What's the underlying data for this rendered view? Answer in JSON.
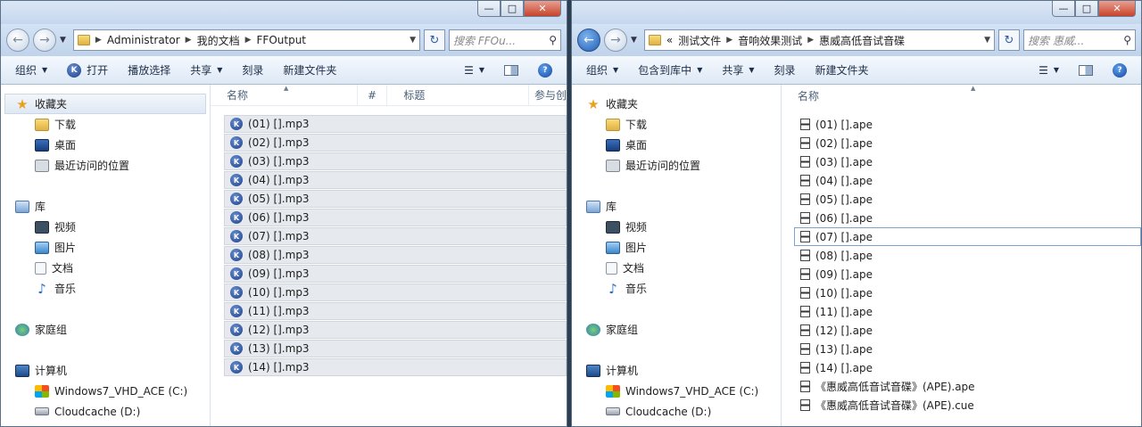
{
  "left": {
    "nav_back_icon": "back-arrow-icon",
    "breadcrumbs": [
      "Administrator",
      "我的文档",
      "FFOutput"
    ],
    "search_placeholder": "搜索 FFOu...",
    "toolbar": {
      "organize": "组织",
      "open": "打开",
      "play_selection": "播放选择",
      "share": "共享",
      "burn": "刻录",
      "new_folder": "新建文件夹"
    },
    "columns": [
      "名称",
      "#",
      "标题",
      "参与创"
    ],
    "files": [
      "(01) [].mp3",
      "(02) [].mp3",
      "(03) [].mp3",
      "(04) [].mp3",
      "(05) [].mp3",
      "(06) [].mp3",
      "(07) [].mp3",
      "(08) [].mp3",
      "(09) [].mp3",
      "(10) [].mp3",
      "(11) [].mp3",
      "(12) [].mp3",
      "(13) [].mp3",
      "(14) [].mp3"
    ]
  },
  "right": {
    "breadcrumbs": [
      "测试文件",
      "音响效果测试",
      "惠威高低音试音碟"
    ],
    "breadcrumb_prefix": "«",
    "search_placeholder": "搜索 惠威...",
    "toolbar": {
      "organize": "组织",
      "include_library": "包含到库中",
      "share": "共享",
      "burn": "刻录",
      "new_folder": "新建文件夹"
    },
    "columns": [
      "名称"
    ],
    "files": [
      "(01) [].ape",
      "(02) [].ape",
      "(03) [].ape",
      "(04) [].ape",
      "(05) [].ape",
      "(06) [].ape",
      "(07) [].ape",
      "(08) [].ape",
      "(09) [].ape",
      "(10) [].ape",
      "(11) [].ape",
      "(12) [].ape",
      "(13) [].ape",
      "(14) [].ape",
      "《惠威高低音试音碟》(APE).ape",
      "《惠威高低音试音碟》(APE).cue"
    ]
  },
  "nav": {
    "favorites": "收藏夹",
    "downloads": "下载",
    "desktop": "桌面",
    "recent": "最近访问的位置",
    "libraries": "库",
    "videos": "视频",
    "pictures": "图片",
    "documents": "文档",
    "music": "音乐",
    "homegroup": "家庭组",
    "computer": "计算机",
    "drive_c": "Windows7_VHD_ACE (C:)",
    "drive_d": "Cloudcache (D:)"
  },
  "window_buttons": {
    "min": "—",
    "max": "□",
    "close": "✕"
  },
  "colors": {
    "title_gradient": "#c5d7ee",
    "selected_file_bg": "#e6e9ed",
    "accent": "#1d3f8a"
  }
}
